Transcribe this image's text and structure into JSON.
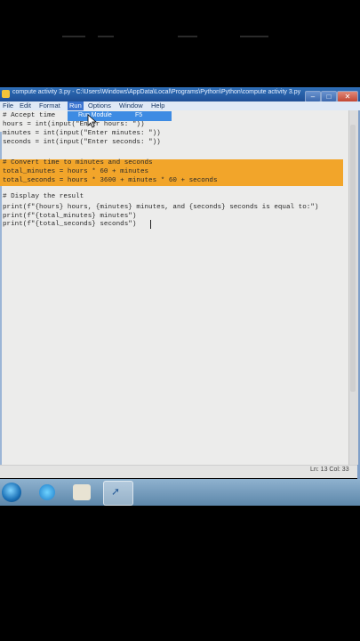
{
  "window": {
    "title": "compute activity 3.py - C:\\Users\\Windows\\AppData\\Local\\Programs\\Python\\Python\\compute activity 3.py",
    "minimize": "–",
    "maximize": "□",
    "close": "✕"
  },
  "menu": {
    "items": [
      "File",
      "Edit",
      "Format",
      "Run",
      "Options",
      "Window",
      "Help"
    ]
  },
  "dropdown": {
    "label": "Run Module",
    "shortcut": "F5"
  },
  "code": {
    "lines": [
      "# Accept time",
      "hours = int(input(\"Enter hours: \"))",
      "minutes = int(input(\"Enter minutes: \"))",
      "seconds = int(input(\"Enter seconds: \"))",
      "",
      "# Convert time to minutes and seconds",
      "total_minutes = hours * 60 + minutes",
      "total_seconds = hours * 3600 + minutes * 60 + seconds",
      "",
      "# Display the result",
      "print(f\"{hours} hours, {minutes} minutes, and {seconds} seconds is equal to:\")",
      "print(f\"{total_minutes} minutes\")",
      "print(f\"{total_seconds} seconds\")"
    ]
  },
  "status": {
    "position": "Ln: 13   Col: 33"
  },
  "colors": {
    "highlight": "#f2a52a",
    "titlebar": "#2f6fb8",
    "editor_bg": "#ececeb"
  },
  "taskbar": {
    "icons": [
      "start-orb-icon",
      "internet-explorer-icon",
      "folder-icon",
      "python-idle-icon"
    ]
  }
}
